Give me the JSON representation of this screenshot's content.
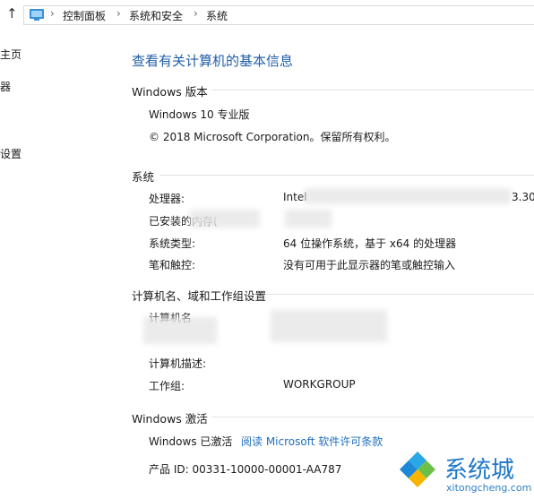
{
  "breadcrumb": {
    "items": [
      "控制面板",
      "系统和安全",
      "系统"
    ],
    "separator": "›"
  },
  "nav": {
    "items": [
      "主页",
      "器",
      "设置"
    ]
  },
  "page_title": "查看有关计算机的基本信息",
  "windows_edition": {
    "heading": "Windows 版本",
    "edition": "Windows 10 专业版",
    "copyright": "© 2018 Microsoft Corporation。保留所有权利。"
  },
  "system": {
    "heading": "系统",
    "rows": [
      {
        "label": "处理器:",
        "value": "Intel",
        "value_tail": "3.30"
      },
      {
        "label": "已安装的内存(",
        "value": ""
      },
      {
        "label": "系统类型:",
        "value": "64 位操作系统，基于 x64 的处理器"
      },
      {
        "label": "笔和触控:",
        "value": "没有可用于此显示器的笔或触控输入"
      }
    ]
  },
  "computer": {
    "heading": "计算机名、域和工作组设置",
    "rows": [
      {
        "label": "计算机名",
        "value": ""
      },
      {
        "label": "计算机描述:",
        "value": ""
      },
      {
        "label": "工作组:",
        "value": "WORKGROUP"
      }
    ]
  },
  "activation": {
    "heading": "Windows 激活",
    "status": "Windows 已激活",
    "license_link": "阅读 Microsoft 软件许可条款",
    "product_id": "产品 ID: 00331-10000-00001-AA787"
  },
  "watermark": {
    "brand": "系统城",
    "url": "xitongcheng.com"
  },
  "colors": {
    "title_blue": "#1f5ea8",
    "link_blue": "#1f6fbf"
  }
}
